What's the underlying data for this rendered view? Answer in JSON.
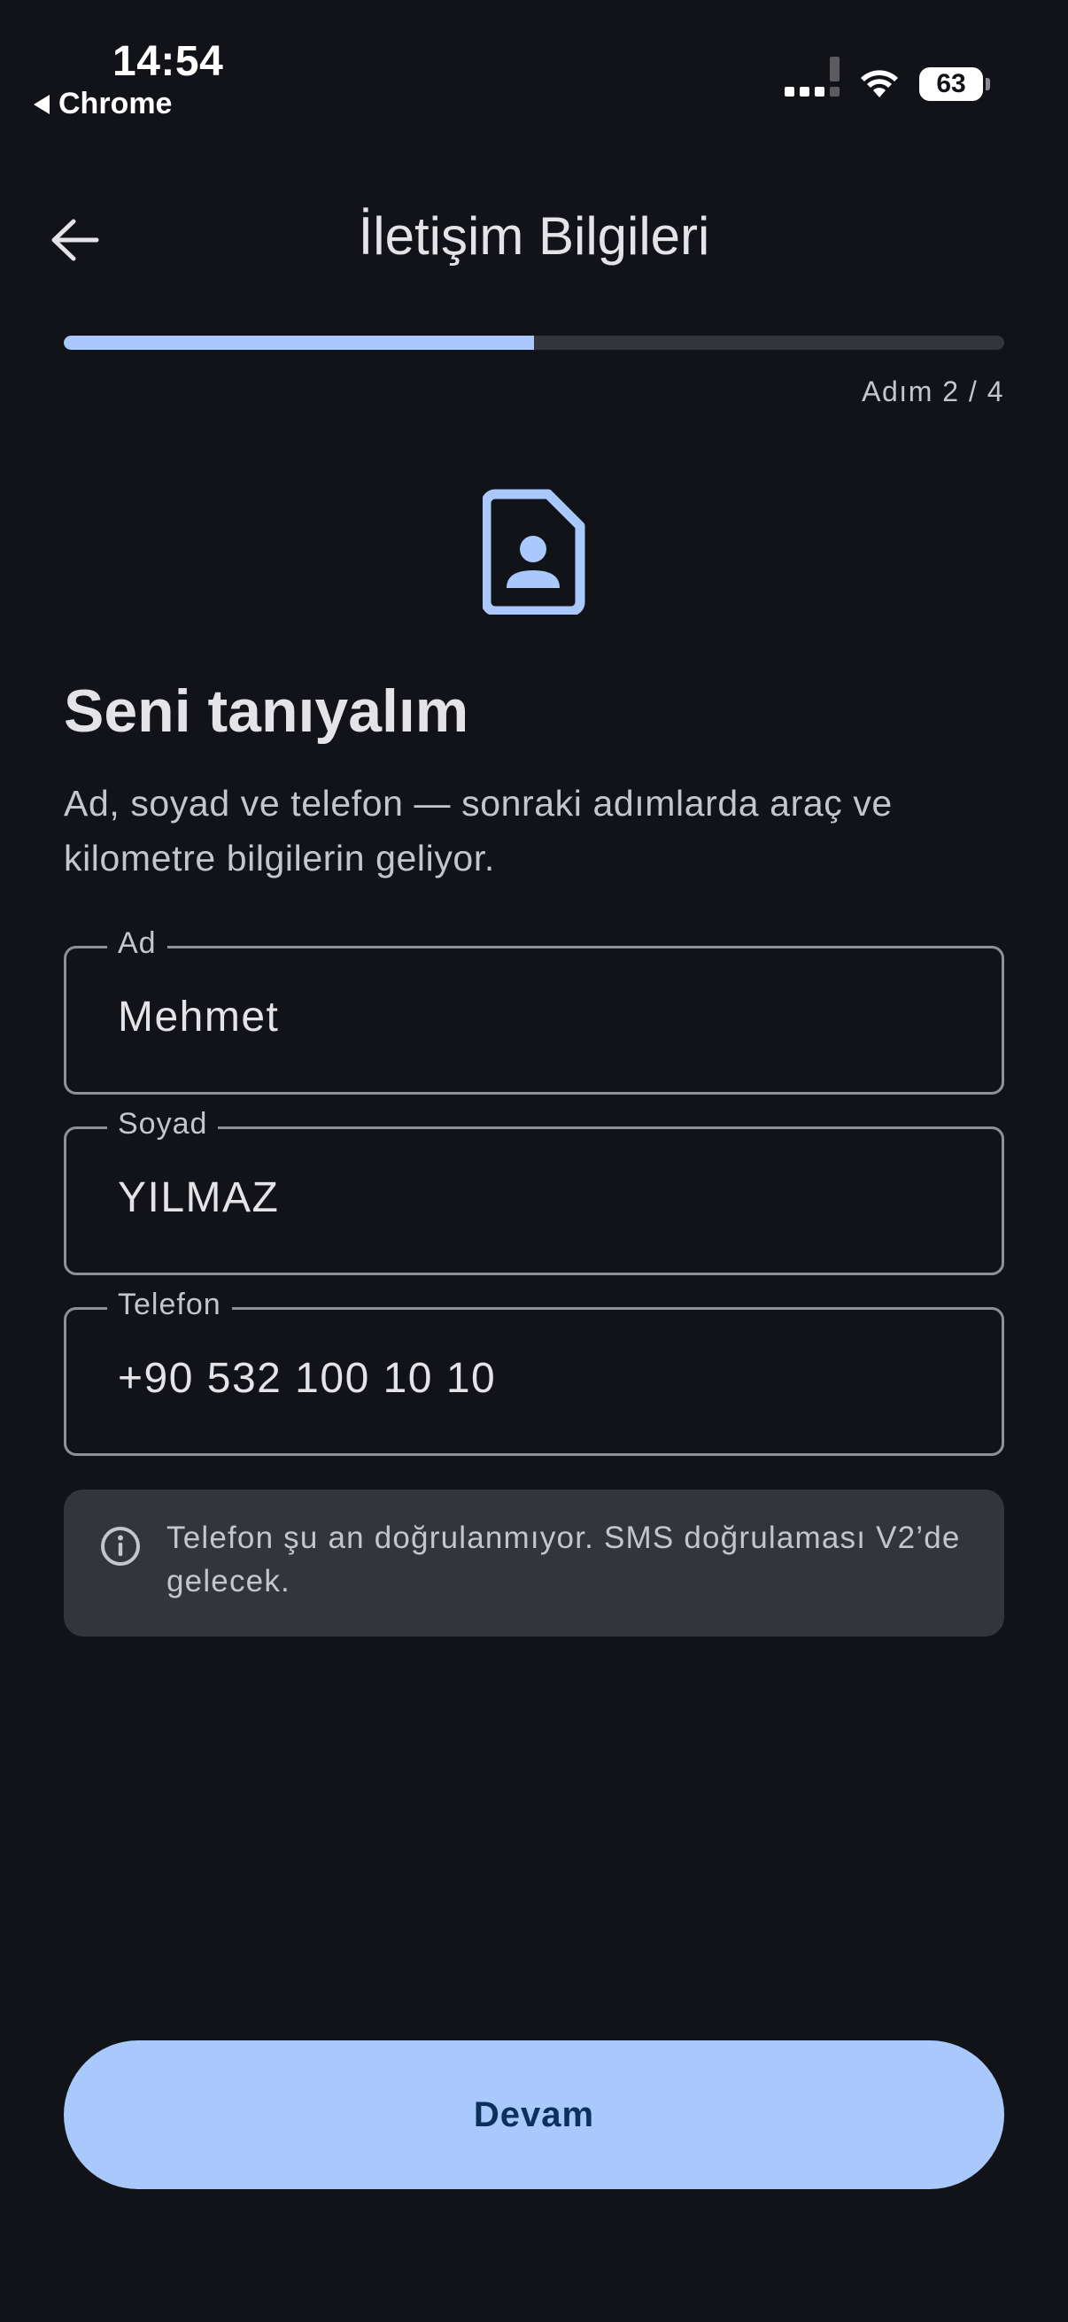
{
  "status_bar": {
    "time": "14:54",
    "back_app": "Chrome",
    "battery": "63",
    "icons": [
      "signal-icon",
      "wifi-icon",
      "battery-icon"
    ]
  },
  "app_bar": {
    "title": "İletişim Bilgileri",
    "back_icon": "arrow-left-icon"
  },
  "progress": {
    "step_label": "Adım 2 / 4",
    "fraction": 0.5
  },
  "hero": {
    "icon": "contact-page-icon",
    "heading": "Seni tanıyalım",
    "subtext": "Ad, soyad ve telefon — sonraki adımlarda araç ve kilometre bilgilerin geliyor."
  },
  "form": {
    "first_name": {
      "label": "Ad",
      "value": "Mehmet"
    },
    "last_name": {
      "label": "Soyad",
      "value": "YILMAZ"
    },
    "phone": {
      "label": "Telefon",
      "value": "+90 532 100 10 10"
    }
  },
  "info": {
    "icon": "info-icon",
    "text": "Telefon şu an doğrulanmıyor. SMS doğrulaması V2’de gelecek."
  },
  "actions": {
    "continue_label": "Devam"
  },
  "colors": {
    "background": "#111318",
    "accent": "#a9c8fb",
    "surface": "#33353b",
    "on_accent": "#0d2f5c",
    "outline": "#8e9199"
  }
}
